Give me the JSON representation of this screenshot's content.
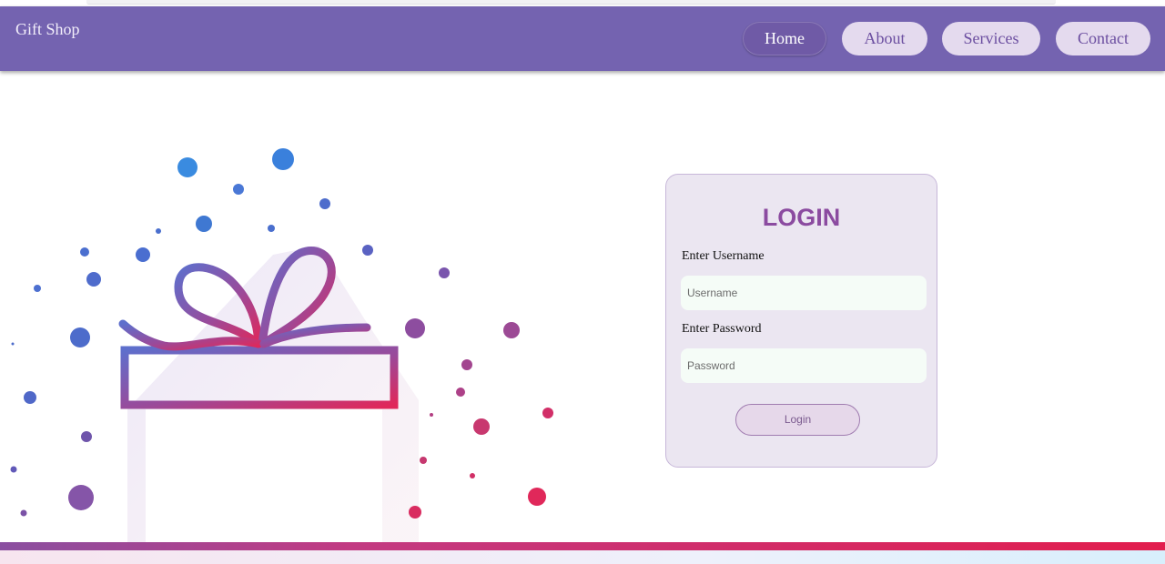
{
  "brand": "Gift Shop",
  "nav": {
    "items": [
      {
        "label": "Home",
        "active": true
      },
      {
        "label": "About",
        "active": false
      },
      {
        "label": "Services",
        "active": false
      },
      {
        "label": "Contact",
        "active": false
      }
    ]
  },
  "login": {
    "title": "LOGIN",
    "username_label": "Enter Username",
    "username_placeholder": "Username",
    "username_value": "",
    "password_label": "Enter Password",
    "password_placeholder": "Password",
    "password_value": "",
    "submit_label": "Login"
  },
  "colors": {
    "navbar": "#7463b0",
    "title": "#8b4ba0",
    "gift_gradient_start": "#5e6fcc",
    "gift_gradient_end": "#e0285a",
    "footer_gradient_start": "#8a4fa0",
    "footer_gradient_end": "#e21d4d"
  },
  "illustration": {
    "icon": "gift-box-icon"
  }
}
